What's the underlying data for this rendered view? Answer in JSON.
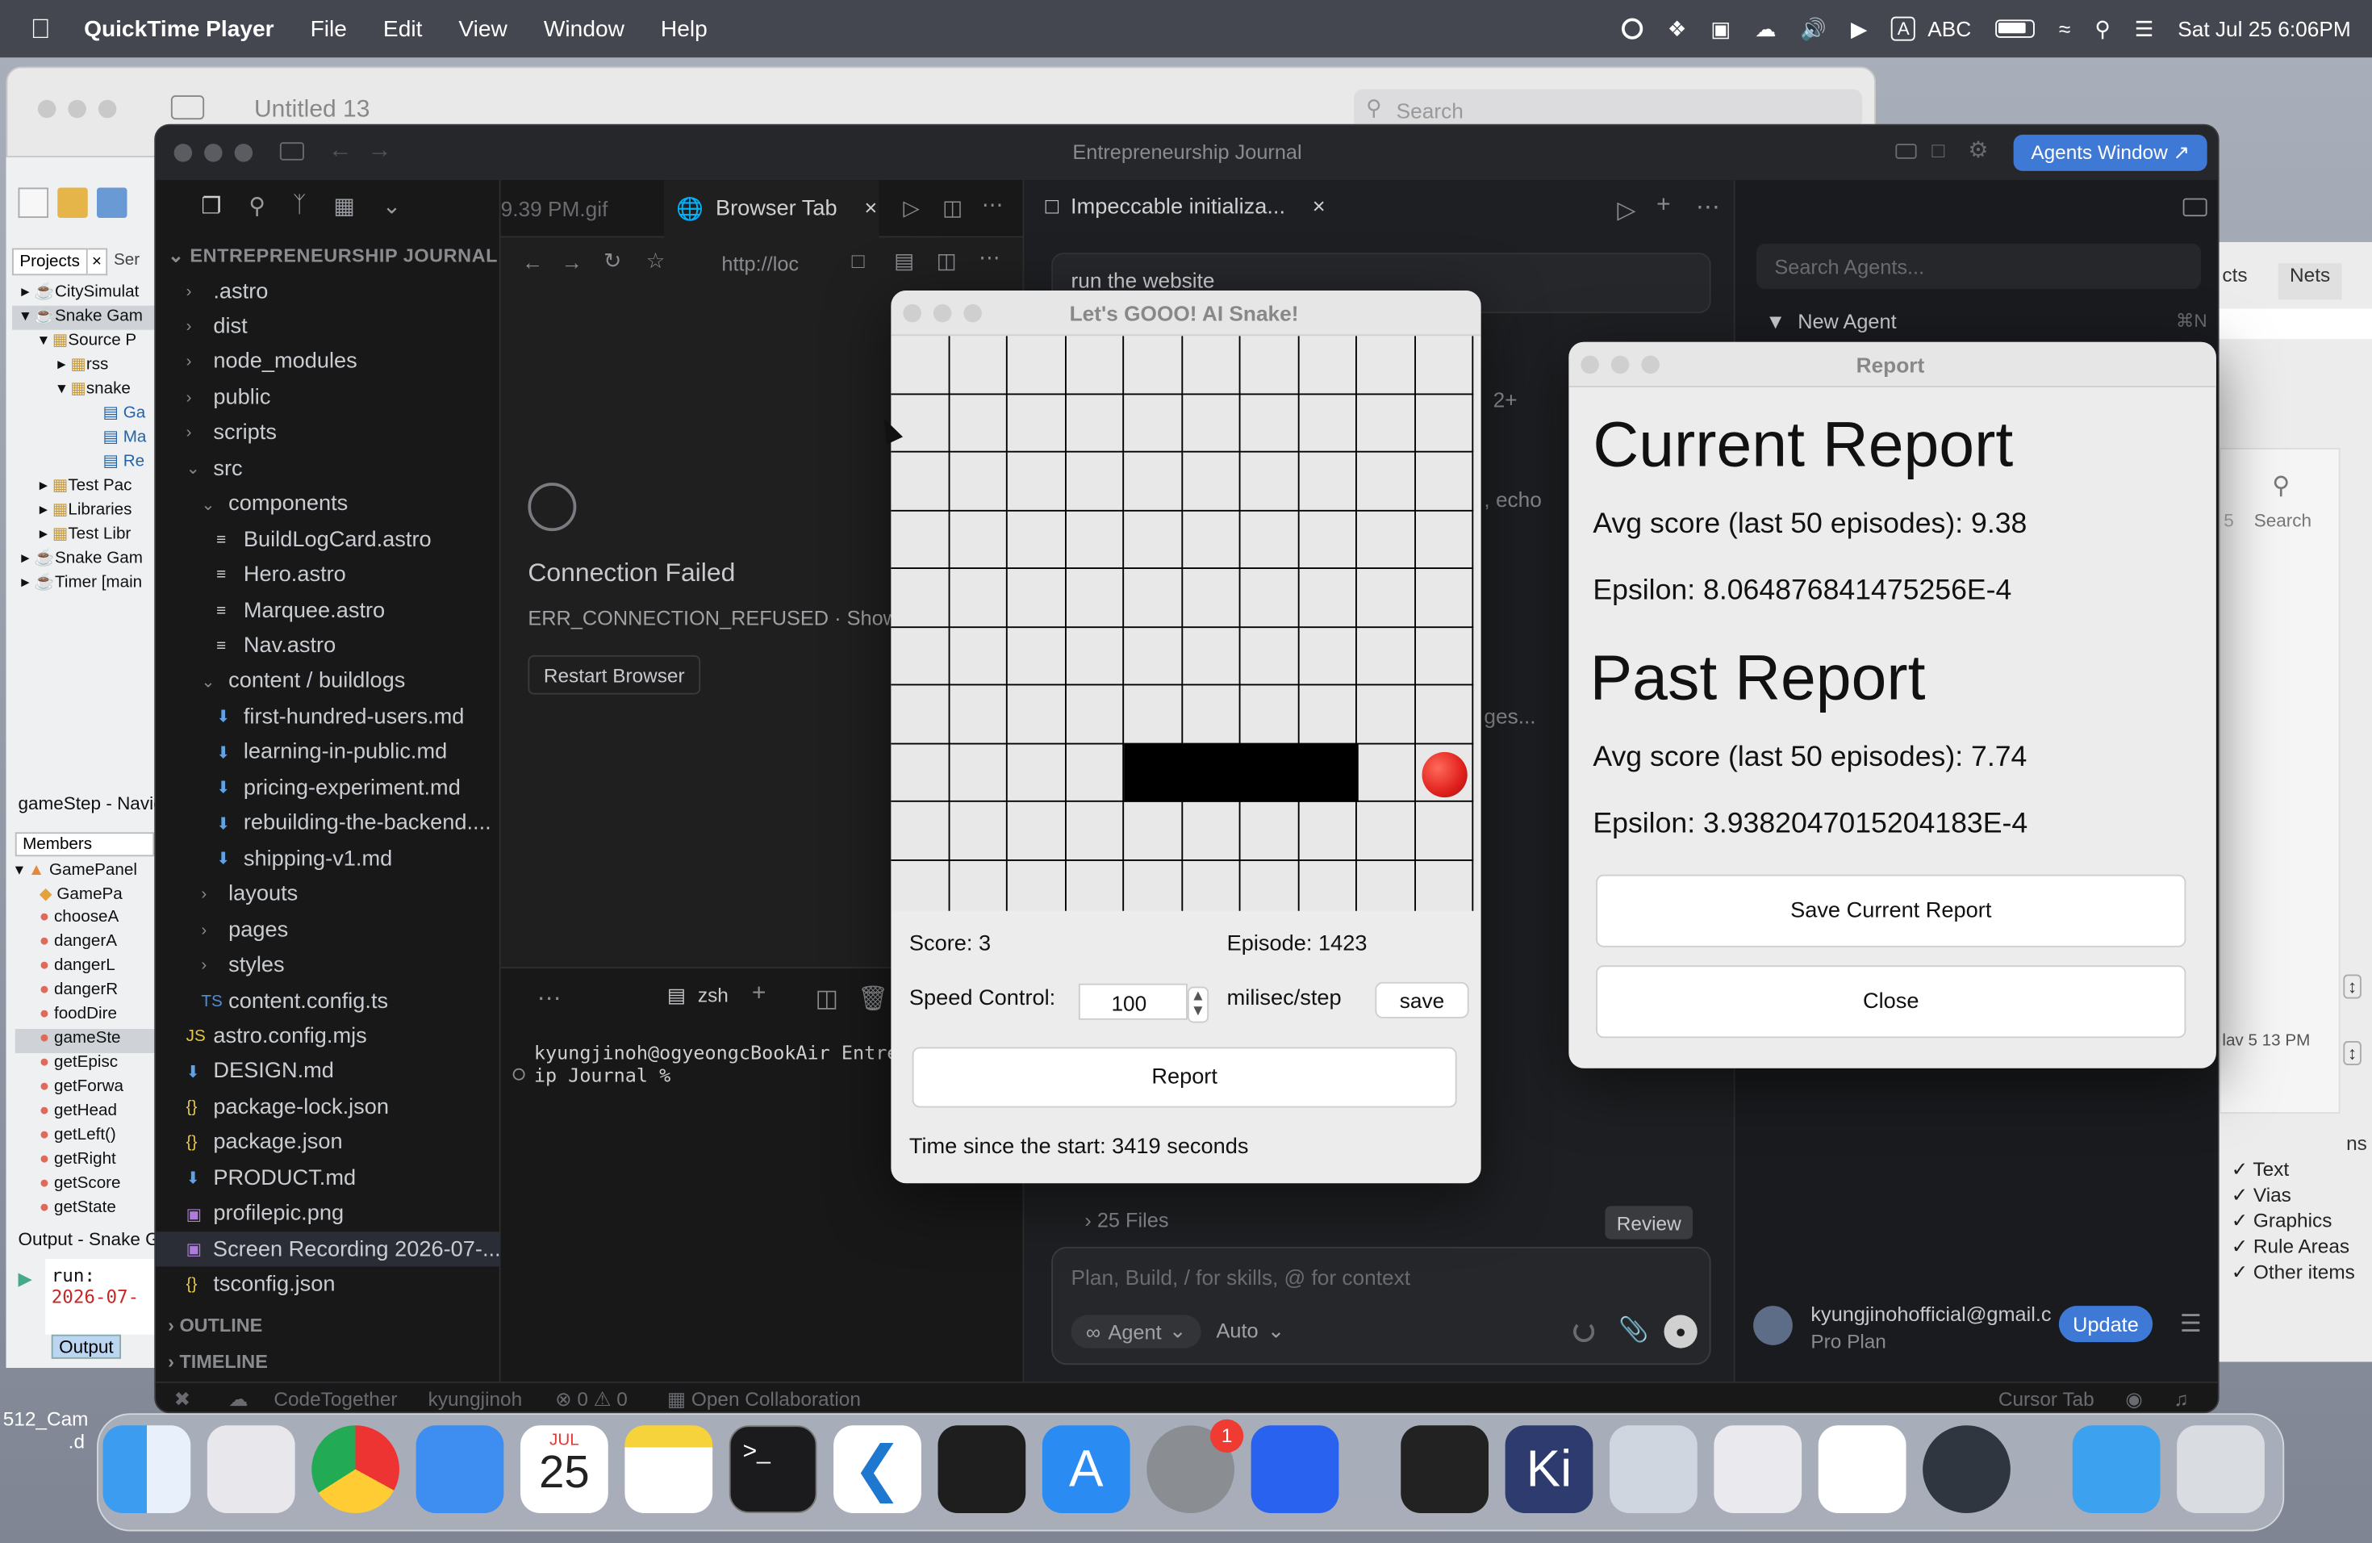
{
  "menubar": {
    "app": "QuickTime Player",
    "items": [
      "File",
      "Edit",
      "View",
      "Window",
      "Help"
    ],
    "status": {
      "input_source": "ABC",
      "datetime": "Sat Jul 25  6:06PM"
    }
  },
  "quicktime": {
    "title": "Untitled 13",
    "search_placeholder": "Search"
  },
  "netbeans": {
    "tabs": [
      "Projects",
      "Ser"
    ],
    "projects": [
      {
        "label": "CitySimulat"
      },
      {
        "label": "Snake Gam"
      },
      {
        "label": "Source P"
      },
      {
        "label": "rss"
      },
      {
        "label": "snake"
      },
      {
        "label": "Ga"
      },
      {
        "label": "Ma"
      },
      {
        "label": "Re"
      },
      {
        "label": "Test Pac"
      },
      {
        "label": "Libraries"
      },
      {
        "label": "Test Libr"
      },
      {
        "label": "Snake Gam"
      },
      {
        "label": "Timer [main"
      }
    ],
    "navigator_title": "gameStep - Navig",
    "members_label": "Members",
    "members": [
      "GamePanel",
      "GamePa",
      "chooseA",
      "dangerA",
      "dangerL",
      "dangerR",
      "foodDire",
      "gameSte",
      "getEpisc",
      "getForwa",
      "getHead",
      "getLeft()",
      "getRight",
      "getScore",
      "getState"
    ],
    "output_title": "Output - Snake G",
    "output_lines": [
      "run:",
      "2026-07-"
    ],
    "output_tab": "Output"
  },
  "editor": {
    "title": "Entrepreneurship Journal",
    "agents_button": "Agents Window ↗",
    "explorer_header": "ENTREPRENEURSHIP JOURNAL",
    "tree": [
      {
        "label": ".astro",
        "kind": "folder",
        "depth": 0
      },
      {
        "label": "dist",
        "kind": "folder",
        "depth": 0
      },
      {
        "label": "node_modules",
        "kind": "folder",
        "depth": 0
      },
      {
        "label": "public",
        "kind": "folder",
        "depth": 0
      },
      {
        "label": "scripts",
        "kind": "folder",
        "depth": 0
      },
      {
        "label": "src",
        "kind": "folder-open",
        "depth": 0
      },
      {
        "label": "components",
        "kind": "folder-open",
        "depth": 1
      },
      {
        "label": "BuildLogCard.astro",
        "kind": "astro",
        "depth": 2
      },
      {
        "label": "Hero.astro",
        "kind": "astro",
        "depth": 2
      },
      {
        "label": "Marquee.astro",
        "kind": "astro",
        "depth": 2
      },
      {
        "label": "Nav.astro",
        "kind": "astro",
        "depth": 2
      },
      {
        "label": "content / buildlogs",
        "kind": "folder-open",
        "depth": 1
      },
      {
        "label": "first-hundred-users.md",
        "kind": "md",
        "depth": 2
      },
      {
        "label": "learning-in-public.md",
        "kind": "md",
        "depth": 2
      },
      {
        "label": "pricing-experiment.md",
        "kind": "md",
        "depth": 2
      },
      {
        "label": "rebuilding-the-backend....",
        "kind": "md",
        "depth": 2
      },
      {
        "label": "shipping-v1.md",
        "kind": "md",
        "depth": 2
      },
      {
        "label": "layouts",
        "kind": "folder",
        "depth": 1
      },
      {
        "label": "pages",
        "kind": "folder",
        "depth": 1
      },
      {
        "label": "styles",
        "kind": "folder",
        "depth": 1
      },
      {
        "label": "content.config.ts",
        "kind": "ts",
        "depth": 1
      },
      {
        "label": "astro.config.mjs",
        "kind": "js",
        "depth": 0
      },
      {
        "label": "DESIGN.md",
        "kind": "md",
        "depth": 0
      },
      {
        "label": "package-lock.json",
        "kind": "json",
        "depth": 0
      },
      {
        "label": "package.json",
        "kind": "json",
        "depth": 0
      },
      {
        "label": "PRODUCT.md",
        "kind": "md",
        "depth": 0
      },
      {
        "label": "profilepic.png",
        "kind": "img",
        "depth": 0
      },
      {
        "label": "Screen Recording 2026-07-...",
        "kind": "img",
        "depth": 0
      },
      {
        "label": "tsconfig.json",
        "kind": "json",
        "depth": 0
      }
    ],
    "outline_label": "OUTLINE",
    "timeline_label": "TIMELINE",
    "gif_tab": "9.39 PM.gif",
    "browser_tab": "Browser Tab",
    "url": "http://loc",
    "connection_failed": "Connection Failed",
    "error_code": "ERR_CONNECTION_REFUSED",
    "show_label": "Show",
    "restart_button": "Restart Browser",
    "terminal_shell": "zsh",
    "terminal_lines": [
      "kyungjinoh@ogyeongcBookAir Entre",
      "ip Journal %"
    ],
    "chat_tab": "Impeccable initializa...",
    "chat_message": "run the website",
    "chat_fragments": [
      "2+",
      ", echo",
      "ges..."
    ],
    "files_changed": "25 Files",
    "review_button": "Review",
    "chat_placeholder": "Plan, Build, / for skills, @ for context",
    "agent_mode": "Agent",
    "model_mode": "Auto",
    "agents_search_placeholder": "Search Agents...",
    "new_agent": "New Agent",
    "new_agent_shortcut": "⌘N",
    "account_email": "kyungjinohofficial@gmail.c",
    "plan": "Pro Plan",
    "update_button": "Update",
    "status": {
      "codetogether": "CodeTogether",
      "user": "kyungjinoh",
      "problems": "⊗ 0 ⚠ 0",
      "collab": "Open Collaboration",
      "cursor_tab": "Cursor Tab"
    }
  },
  "right_panel": {
    "tab1": "cts",
    "tab2": "Nets",
    "search": "Search",
    "items": [
      "Text",
      "Vias",
      "Graphics",
      "Rule Areas",
      "Other items"
    ],
    "truncated": [
      "ns",
      "lav 5 13 PM",
      "5"
    ]
  },
  "snake": {
    "title": "Let's GOOO! AI Snake!",
    "score": "Score: 3",
    "episode": "Episode: 1423",
    "speed_label": "Speed Control:",
    "speed_value": "100",
    "speed_unit": "milisec/step",
    "save_button": "save",
    "report_button": "Report",
    "time": "Time since the start: 3419 seconds",
    "board": {
      "cols": 10,
      "rows": 10,
      "snake_cells": [
        [
          4,
          7
        ],
        [
          5,
          7
        ],
        [
          6,
          7
        ],
        [
          7,
          7
        ]
      ],
      "food_cell": [
        9,
        7
      ],
      "food_icon": "apple-icon"
    }
  },
  "report": {
    "title": "Report",
    "current_heading": "Current Report",
    "current_avg": "Avg score (last 50 episodes): 9.38",
    "current_epsilon": "Epsilon: 8.064876841475256E-4",
    "past_heading": "Past Report",
    "past_avg": "Avg score (last 50 episodes): 7.74",
    "past_epsilon": "Epsilon: 3.9382047015204183E-4",
    "save_button": "Save Current Report",
    "close_button": "Close"
  },
  "desktop": {
    "file_label": "512_Cam",
    "file_label2": ".d"
  },
  "dock": {
    "calendar": {
      "month": "JUL",
      "day": "25"
    },
    "settings_badge": "1",
    "icons": [
      "finder-icon",
      "launchpad-icon",
      "chrome-icon",
      "mail-icon",
      "calendar-icon",
      "notes-icon",
      "terminal-icon",
      "vscode-icon",
      "figma-icon",
      "appstore-icon",
      "settings-icon",
      "roblox-icon",
      "unity-icon",
      "kicad-icon",
      "preview-icon",
      "hexagon-icon",
      "netbeans-icon",
      "quicktime-icon",
      "folder-icon",
      "trash-icon"
    ]
  },
  "colors": {
    "editor_bg": "#1e1f22",
    "sidebar_bg": "#181818",
    "accent": "#3574f0",
    "snake": "#000000",
    "food": "#e0201c",
    "dialog_bg": "#ececec"
  }
}
